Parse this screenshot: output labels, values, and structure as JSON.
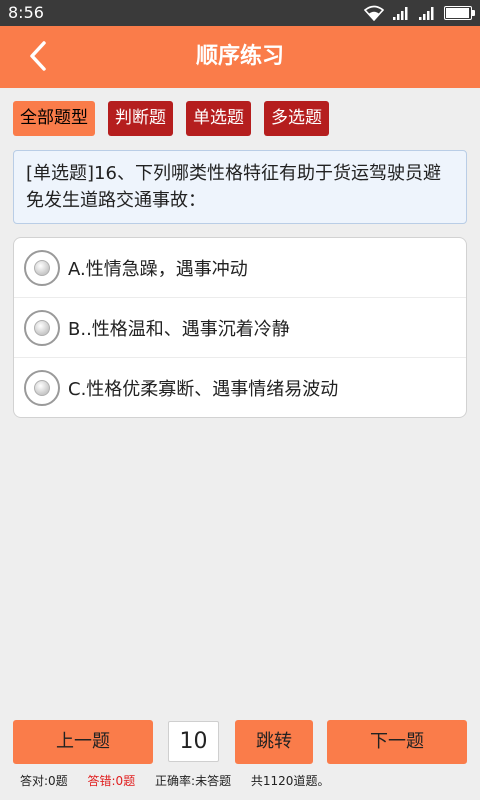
{
  "status_bar": {
    "time": "8:56",
    "battery_level": 0.95
  },
  "header": {
    "title": "顺序练习",
    "back_icon": "chevron-left-icon"
  },
  "filters": [
    {
      "label": "全部题型",
      "active": true
    },
    {
      "label": "判断题",
      "active": false
    },
    {
      "label": "单选题",
      "active": false
    },
    {
      "label": "多选题",
      "active": false
    }
  ],
  "colors": {
    "accent": "#fa7c4a",
    "inactive_filter": "#b51e1e",
    "wrong_count": "#e02020"
  },
  "question": {
    "text": "[单选题]16、下列哪类性格特征有助于货运驾驶员避免发生道路交通事故："
  },
  "options": [
    {
      "text": "A.性情急躁，遇事冲动"
    },
    {
      "text": "B..性格温和、遇事沉着冷静"
    },
    {
      "text": "C.性格优柔寡断、遇事情绪易波动"
    }
  ],
  "nav": {
    "prev": "上一题",
    "page_value": "10",
    "jump": "跳转",
    "next": "下一题"
  },
  "stats": {
    "correct": "答对:0题",
    "wrong": "答错:0题",
    "accuracy": "正确率:未答题",
    "total": "共1120道题。"
  }
}
